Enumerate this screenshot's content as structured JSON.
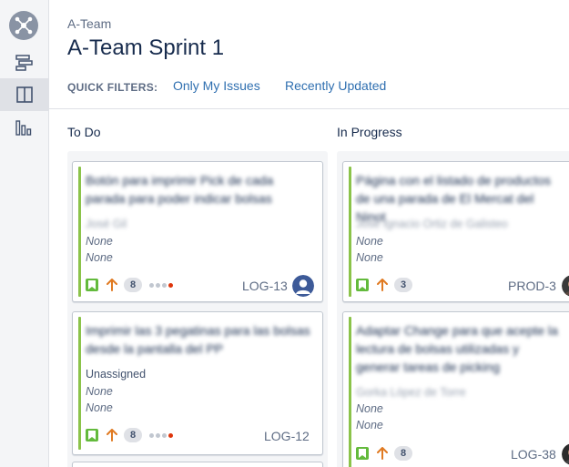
{
  "header": {
    "project_name": "A-Team",
    "board_title": "A-Team Sprint 1"
  },
  "quick_filters": {
    "label": "QUICK FILTERS:",
    "items": [
      {
        "label": "Only My Issues"
      },
      {
        "label": "Recently Updated"
      }
    ]
  },
  "rail": {
    "items": [
      {
        "icon": "backlog-icon"
      },
      {
        "icon": "board-icon",
        "active": true
      },
      {
        "icon": "reports-icon"
      }
    ]
  },
  "columns": [
    {
      "title": "To Do",
      "cards": [
        {
          "summary": "Botón para imprimir Pick de cada parada para poder indicar bolsas",
          "assignee": "José Gil",
          "fields": [
            "None",
            "None"
          ],
          "points": "8",
          "key": "LOG-13"
        },
        {
          "summary": "Imprimir las 3 pegatinas para las bolsas desde la pantalla del PP",
          "assignee": "Unassigned",
          "fields": [
            "None",
            "None"
          ],
          "points": "8",
          "key": "LOG-12"
        }
      ]
    },
    {
      "title": "In Progress",
      "cards": [
        {
          "summary": "Página con el listado de productos de una parada de El Mercat del Ninot",
          "assignee": "José Ignacio Ortiz de Galisteo",
          "fields": [
            "None",
            "None"
          ],
          "points": "3",
          "key": "PROD-3"
        },
        {
          "summary": "Adaptar Change para que acepte la lectura de bolsas utilizadas y generar tareas de picking",
          "assignee": "Gorka López de Torre",
          "fields": [
            "None",
            "None"
          ],
          "points": "8",
          "key": "LOG-38"
        }
      ]
    }
  ],
  "colors": {
    "link": "#2f6fb0",
    "story": "#63ba3c",
    "priority_high": "#e07a22",
    "stripe": "#8bc34a",
    "flag_dot": "#de350b"
  }
}
